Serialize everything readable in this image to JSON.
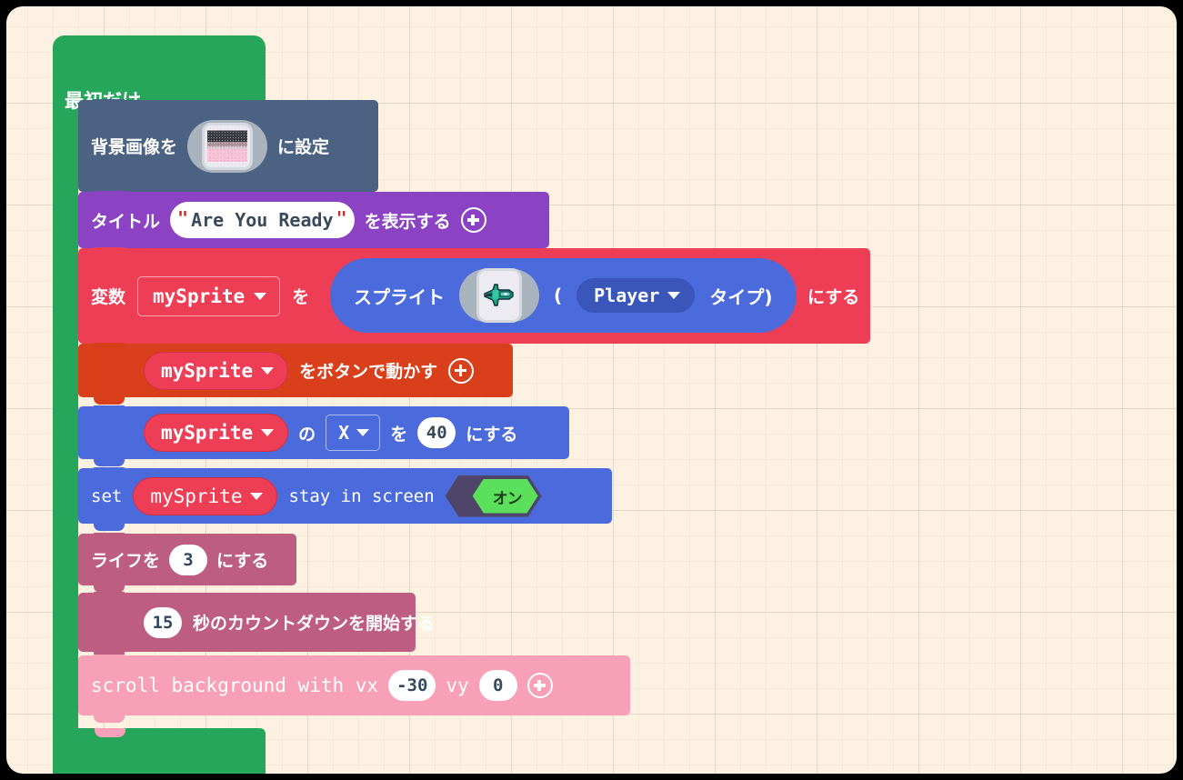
{
  "editor": {
    "kind": "makecode-arcade-blocks",
    "language": "ja",
    "canvas_background": "#fdf2e2",
    "frame_color": "#000000"
  },
  "palette": {
    "event_green": "#26a65b",
    "scene_slate": "#4c6282",
    "text_purple": "#8b43c4",
    "variables_red": "#ee3e56",
    "controller_orange": "#d93f1a",
    "sprites_blue": "#4b6bdc",
    "info_rose": "#bd5d80",
    "scrolling_pink": "#f7a0b8",
    "toggle_on_green": "#5ae05a",
    "toggle_track": "#4e4569"
  },
  "script": {
    "event": {
      "label": "最初だけ",
      "name": "on-start"
    },
    "blocks": [
      {
        "id": "set-background-image",
        "prefix": "背景画像を",
        "suffix": "に設定",
        "image_field": "background-image-thumbnail"
      },
      {
        "id": "show-title",
        "prefix": "タイトル",
        "string_value": "Are You Ready",
        "quote": "\"",
        "suffix": "を表示する",
        "mutator": "+"
      },
      {
        "id": "set-variable-to-sprite",
        "prefix": "変数",
        "variable": "mySprite",
        "particle": "を",
        "inner": {
          "label": "スプライト",
          "image_field": "sprite-thumbnail",
          "open_paren": "(",
          "kind": "Player",
          "kind_suffix": "タイプ)"
        },
        "suffix": "にする"
      },
      {
        "id": "move-sprite-with-buttons",
        "variable": "mySprite",
        "label": "をボタンで動かす",
        "mutator": "+"
      },
      {
        "id": "set-sprite-property",
        "variable": "mySprite",
        "particle": "の",
        "property": "X",
        "particle2": "を",
        "value": "40",
        "suffix": "にする"
      },
      {
        "id": "set-stay-in-screen",
        "prefix": "set",
        "variable": "mySprite",
        "label": "stay in screen",
        "toggle_value": "オン"
      },
      {
        "id": "set-life",
        "prefix": "ライフを",
        "value": "3",
        "suffix": "にする"
      },
      {
        "id": "start-countdown",
        "value": "15",
        "label": "秒のカウントダウンを開始する"
      },
      {
        "id": "scroll-background",
        "label": "scroll background with vx",
        "vx": "-30",
        "vy_label": "vy",
        "vy": "0",
        "mutator": "+"
      }
    ]
  }
}
